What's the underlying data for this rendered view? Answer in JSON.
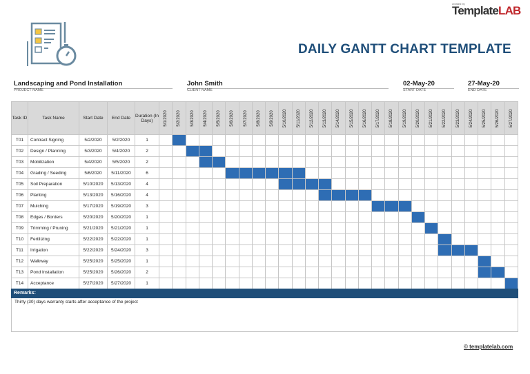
{
  "brand": {
    "small": "created by",
    "name_a": "Template",
    "name_b": "LAB"
  },
  "title": "DAILY GANTT CHART TEMPLATE",
  "project": {
    "value": "Landscaping and Pond Installation",
    "label": "PROJECT NAME"
  },
  "client": {
    "value": "John Smith",
    "label": "CLIENT NAME"
  },
  "start": {
    "value": "02-May-20",
    "label": "START DATE"
  },
  "end": {
    "value": "27-May-20",
    "label": "END DATE"
  },
  "columns": {
    "id": "Task ID",
    "name": "Task Name",
    "start": "Start Date",
    "end": "End Date",
    "duration": "Duration (In Days)"
  },
  "days": [
    "5/1/2020",
    "5/2/2020",
    "5/3/2020",
    "5/4/2020",
    "5/5/2020",
    "5/6/2020",
    "5/7/2020",
    "5/8/2020",
    "5/9/2020",
    "5/10/2020",
    "5/11/2020",
    "5/12/2020",
    "5/13/2020",
    "5/14/2020",
    "5/15/2020",
    "5/16/2020",
    "5/17/2020",
    "5/18/2020",
    "5/19/2020",
    "5/20/2020",
    "5/21/2020",
    "5/22/2020",
    "5/23/2020",
    "5/24/2020",
    "5/25/2020",
    "5/26/2020",
    "5/27/2020"
  ],
  "tasks": [
    {
      "id": "T01",
      "name": "Contract Signing",
      "start": "5/2/2020",
      "end": "5/2/2020",
      "duration": "1"
    },
    {
      "id": "T02",
      "name": "Design / Planning",
      "start": "5/3/2020",
      "end": "5/4/2020",
      "duration": "2"
    },
    {
      "id": "T03",
      "name": "Mobilization",
      "start": "5/4/2020",
      "end": "5/5/2020",
      "duration": "2"
    },
    {
      "id": "T04",
      "name": "Grading / Seeding",
      "start": "5/6/2020",
      "end": "5/11/2020",
      "duration": "6"
    },
    {
      "id": "T05",
      "name": "Soil Preparation",
      "start": "5/10/2020",
      "end": "5/13/2020",
      "duration": "4"
    },
    {
      "id": "T06",
      "name": "Planting",
      "start": "5/13/2020",
      "end": "5/16/2020",
      "duration": "4"
    },
    {
      "id": "T07",
      "name": "Mulching",
      "start": "5/17/2020",
      "end": "5/19/2020",
      "duration": "3"
    },
    {
      "id": "T08",
      "name": "Edges / Borders",
      "start": "5/20/2020",
      "end": "5/20/2020",
      "duration": "1"
    },
    {
      "id": "T09",
      "name": "Trimming / Pruning",
      "start": "5/21/2020",
      "end": "5/21/2020",
      "duration": "1"
    },
    {
      "id": "T10",
      "name": "Fertilizing",
      "start": "5/22/2020",
      "end": "5/22/2020",
      "duration": "1"
    },
    {
      "id": "T11",
      "name": "Irrigation",
      "start": "5/22/2020",
      "end": "5/24/2020",
      "duration": "3"
    },
    {
      "id": "T12",
      "name": "Walkway",
      "start": "5/25/2020",
      "end": "5/25/2020",
      "duration": "1"
    },
    {
      "id": "T13",
      "name": "Pond Installation",
      "start": "5/25/2020",
      "end": "5/26/2020",
      "duration": "2"
    },
    {
      "id": "T14",
      "name": "Acceptance",
      "start": "5/27/2020",
      "end": "5/27/2020",
      "duration": "1"
    }
  ],
  "remarks": {
    "label": "Remarks:",
    "text": "Thirty (30) days warranty starts after acceptance of the project"
  },
  "footer": "© templatelab.com",
  "colors": {
    "bar": "#2e6db4",
    "accent": "#1f4e79"
  }
}
